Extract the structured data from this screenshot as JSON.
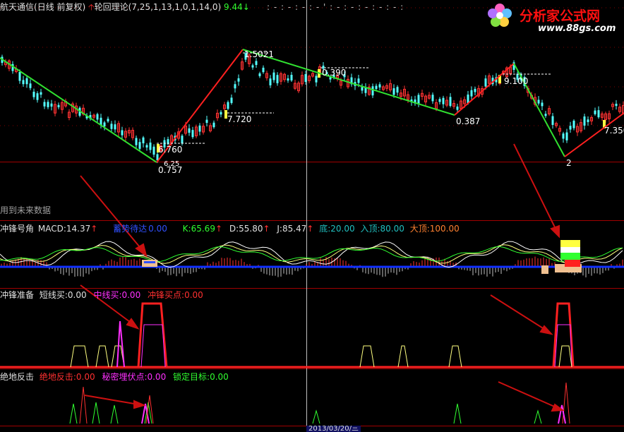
{
  "main_panel": {
    "stock_name": "航天通信",
    "period": "(日线 前复权)",
    "indicator_name": "轮回理论",
    "indicator_params": "(7,25,1,13,1,0,1,14,0)",
    "indicator_value": "9.44",
    "price_labels": [
      "1.5021",
      "7.720",
      "6.760",
      "0.757",
      "6.25",
      "0.390",
      "0.387",
      "9.100",
      "2",
      "7.350"
    ],
    "note": "用到未来数据"
  },
  "macd_panel": {
    "name": "冲锋号角",
    "macd_label": "MACD:",
    "macd_value": "14.37",
    "signal_label": "蓄势待达",
    "signal_value": "0.00",
    "k_label": "K:",
    "k_value": "65.69",
    "d_label": "D:",
    "d_value": "55.80",
    "j_label": "J:",
    "j_value": "85.47",
    "bottom_label": "底:",
    "bottom_value": "20.00",
    "entry_label": "入顶:",
    "entry_value": "80.00",
    "top_label": "大顶:",
    "top_value": "100.00"
  },
  "prep_panel": {
    "name": "冲锋准备",
    "short_label": "短线买:",
    "short_value": "0.00",
    "mid_label": "中线买:",
    "mid_value": "0.00",
    "charge_label": "冲锋买点:",
    "charge_value": "0.00"
  },
  "counter_panel": {
    "name": "绝地反击",
    "counter_label": "绝地反击:",
    "counter_value": "0.00",
    "hidden_label": "秘密埋伏点:",
    "hidden_value": "0.00",
    "lock_label": "锁定目标:",
    "lock_value": "0.00"
  },
  "date_axis": {
    "cursor_date": "2013/03/20/三"
  },
  "logo": {
    "name": "分析家公式网",
    "url": "www.88gs.com"
  },
  "colors": {
    "background": "#000000",
    "up": "#ff3232",
    "down": "#54ffff",
    "trend_up": "#ff2020",
    "trend_down": "#30e030",
    "panel_border": "#a00000",
    "blue_line": "#1030ff",
    "magenta": "#ff30ff",
    "yellow_line": "#ffff80",
    "green": "#30ff30",
    "arrow": "#cc1010"
  }
}
